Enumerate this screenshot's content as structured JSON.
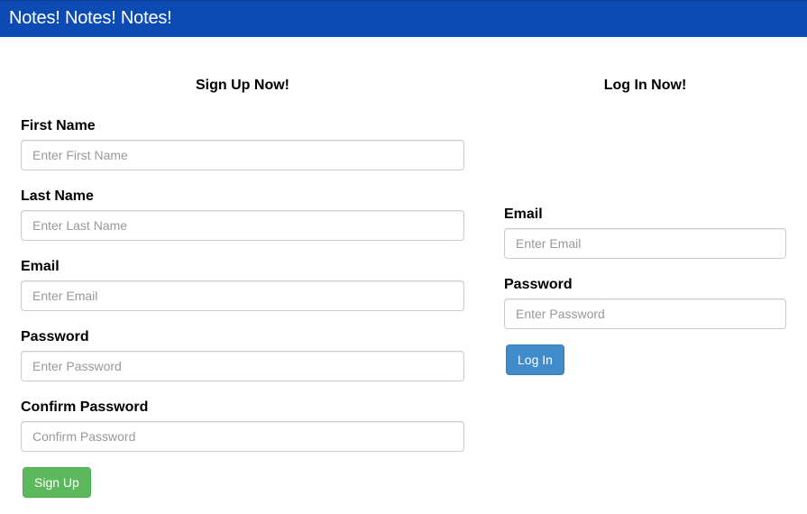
{
  "app": {
    "brand": "Notes! Notes! Notes!"
  },
  "signup": {
    "title": "Sign Up Now!",
    "fields": [
      {
        "label": "First Name",
        "placeholder": "Enter First Name",
        "value": ""
      },
      {
        "label": "Last Name",
        "placeholder": "Enter Last Name",
        "value": ""
      },
      {
        "label": "Email",
        "placeholder": "Enter Email",
        "value": ""
      },
      {
        "label": "Password",
        "placeholder": "Enter Password",
        "value": ""
      },
      {
        "label": "Confirm Password",
        "placeholder": "Confirm Password",
        "value": ""
      }
    ],
    "submit_label": "Sign Up"
  },
  "login": {
    "title": "Log In Now!",
    "fields": [
      {
        "label": "Email",
        "placeholder": "Enter Email",
        "value": ""
      },
      {
        "label": "Password",
        "placeholder": "Enter Password",
        "value": ""
      }
    ],
    "submit_label": "Log In"
  },
  "colors": {
    "navbar": "#0b4bb3",
    "signup_button": "#5cb85c",
    "login_button": "#428bca"
  }
}
